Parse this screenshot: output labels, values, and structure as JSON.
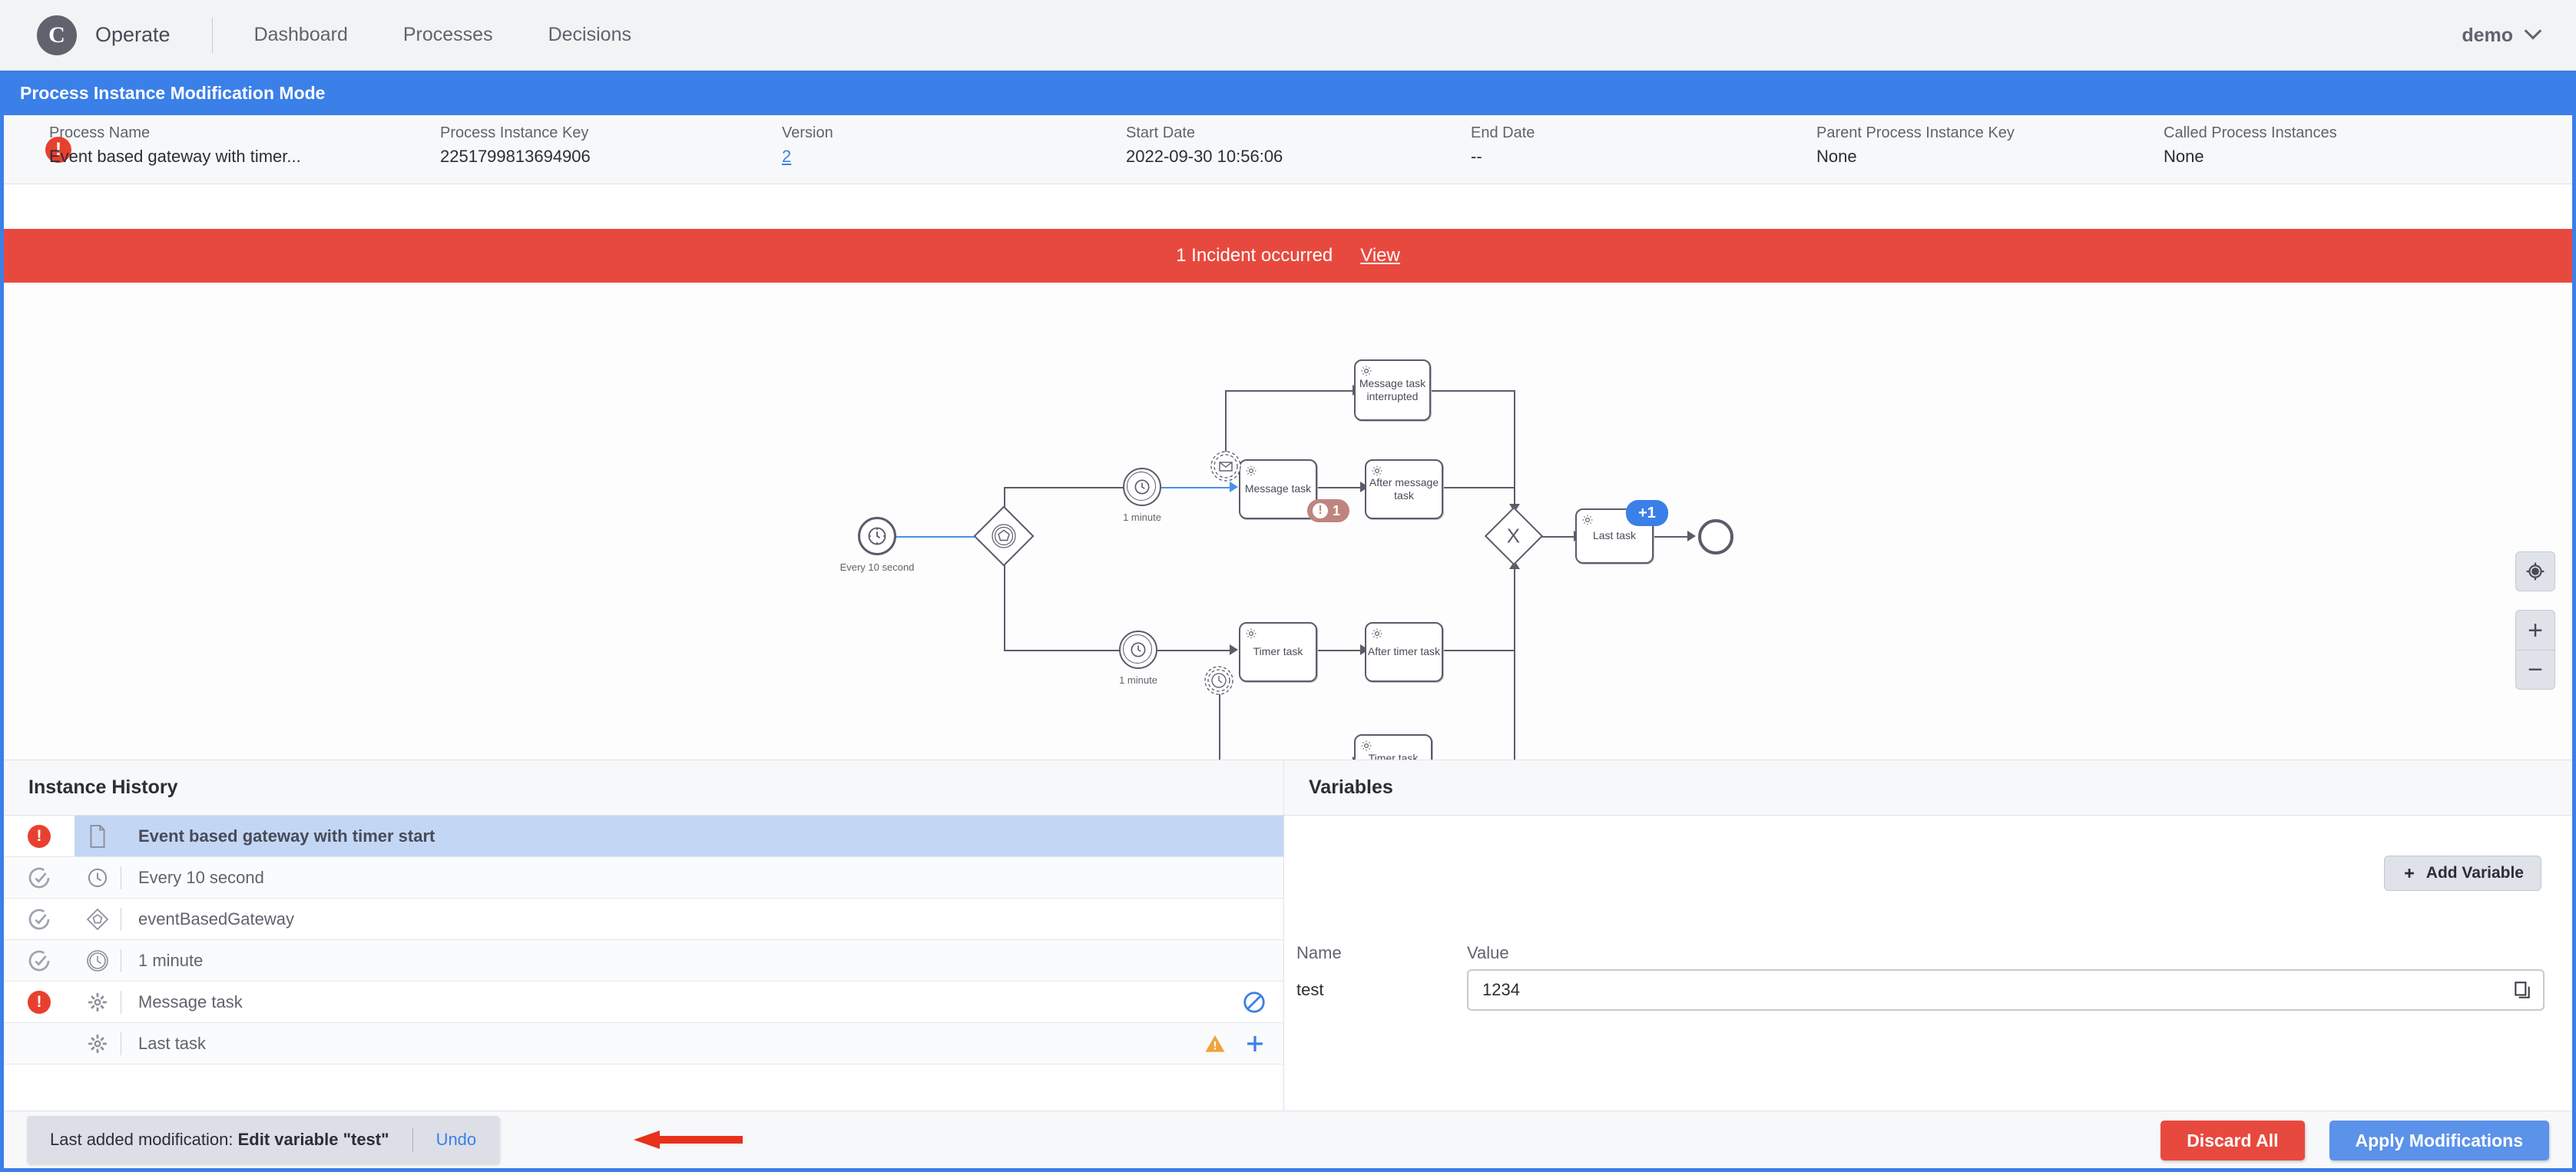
{
  "app": {
    "brand": "Operate",
    "logo_icon": "camunda-logo-icon",
    "nav": [
      {
        "label": "Dashboard",
        "name": "nav-dashboard"
      },
      {
        "label": "Processes",
        "name": "nav-processes"
      },
      {
        "label": "Decisions",
        "name": "nav-decisions"
      }
    ],
    "user": "demo",
    "user_chevron_icon": "chevron-down-icon"
  },
  "modification_banner": {
    "title": "Process Instance Modification Mode"
  },
  "instance_header": {
    "status_icon": "error-icon",
    "fields": [
      {
        "label": "Process Name",
        "value": "Event based gateway with timer...",
        "name": "process-name"
      },
      {
        "label": "Process Instance Key",
        "value": "2251799813694906",
        "name": "process-instance-key"
      },
      {
        "label": "Version",
        "value": "2",
        "name": "version",
        "link": true
      },
      {
        "label": "Start Date",
        "value": "2022-09-30 10:56:06",
        "name": "start-date"
      },
      {
        "label": "End Date",
        "value": "--",
        "name": "end-date"
      },
      {
        "label": "Parent Process Instance Key",
        "value": "None",
        "name": "parent-process-instance-key"
      },
      {
        "label": "Called Process Instances",
        "value": "None",
        "name": "called-process-instances"
      }
    ]
  },
  "incident_bar": {
    "text": "1 Incident occurred",
    "view_label": "View"
  },
  "diagram": {
    "zoom_controls": {
      "reset_icon": "crosshair-target-icon",
      "zoom_in_label": "+",
      "zoom_out_label": "−"
    },
    "nodes": [
      {
        "id": "start-timer",
        "type": "timer-start-event",
        "label": "Every 10 second"
      },
      {
        "id": "event-gateway",
        "type": "event-based-gateway",
        "label": ""
      },
      {
        "id": "timer-catch-top",
        "type": "timer-intermediate-catch-event",
        "label": "1 minute"
      },
      {
        "id": "timer-catch-bottom",
        "type": "timer-intermediate-catch-event",
        "label": "1 minute"
      },
      {
        "id": "message-task",
        "type": "service-task",
        "label": "Message task",
        "incidents": "1",
        "boundary": "message-boundary-event"
      },
      {
        "id": "message-task-interrupted",
        "type": "service-task",
        "label": "Message task interrupted"
      },
      {
        "id": "after-message-task",
        "type": "service-task",
        "label": "After message task"
      },
      {
        "id": "timer-task",
        "type": "service-task",
        "label": "Timer task",
        "boundary": "timer-boundary-event"
      },
      {
        "id": "after-timer-task",
        "type": "service-task",
        "label": "After timer task"
      },
      {
        "id": "timer-task-interrupted",
        "type": "service-task",
        "label": "Timer task interrupted"
      },
      {
        "id": "join-gateway",
        "type": "exclusive-gateway",
        "label": "X"
      },
      {
        "id": "last-task",
        "type": "service-task",
        "label": "Last task",
        "modification_badge": "+1"
      },
      {
        "id": "end-event",
        "type": "end-event",
        "label": ""
      }
    ],
    "incident_badge": "1",
    "modification_badge": "+1"
  },
  "instance_history": {
    "title": "Instance History",
    "rows": [
      {
        "label": "Event based gateway with timer start",
        "state": "incident",
        "icon": "process-document-icon",
        "selected": true,
        "bold": true,
        "indent": 0,
        "actions": []
      },
      {
        "label": "Every 10 second",
        "state": "completed",
        "icon": "timer-event-icon",
        "selected": false,
        "bold": false,
        "indent": 1,
        "actions": []
      },
      {
        "label": "eventBasedGateway",
        "state": "completed",
        "icon": "event-gateway-icon",
        "selected": false,
        "bold": false,
        "indent": 1,
        "actions": []
      },
      {
        "label": "1 minute",
        "state": "completed",
        "icon": "timer-catch-icon",
        "selected": false,
        "bold": false,
        "indent": 1,
        "actions": []
      },
      {
        "label": "Message task",
        "state": "incident",
        "icon": "service-task-icon",
        "selected": false,
        "bold": false,
        "indent": 1,
        "actions": [
          "cancel-icon"
        ]
      },
      {
        "label": "Last task",
        "state": "none",
        "icon": "service-task-icon",
        "selected": false,
        "bold": false,
        "indent": 1,
        "actions": [
          "warning-icon",
          "add-icon"
        ]
      }
    ]
  },
  "variables": {
    "title": "Variables",
    "add_button": {
      "label": "Add Variable",
      "icon": "plus-icon"
    },
    "columns": {
      "name": "Name",
      "value": "Value"
    },
    "rows": [
      {
        "name": "test",
        "value": "1234",
        "copy_icon": "copy-icon"
      }
    ]
  },
  "footer": {
    "toast": {
      "prefix": "Last added modification:",
      "detail": "Edit variable \"test\"",
      "undo_label": "Undo"
    },
    "annotation_arrow": "red-pointer-arrow",
    "discard_label": "Discard All",
    "apply_label": "Apply Modifications"
  },
  "colors": {
    "brand_blue": "#3b7fe8",
    "incident_red": "#e8493e",
    "apply_blue": "#5b92ea",
    "selected_row": "#c3d7f5",
    "badge_incident": "#bf8480"
  }
}
